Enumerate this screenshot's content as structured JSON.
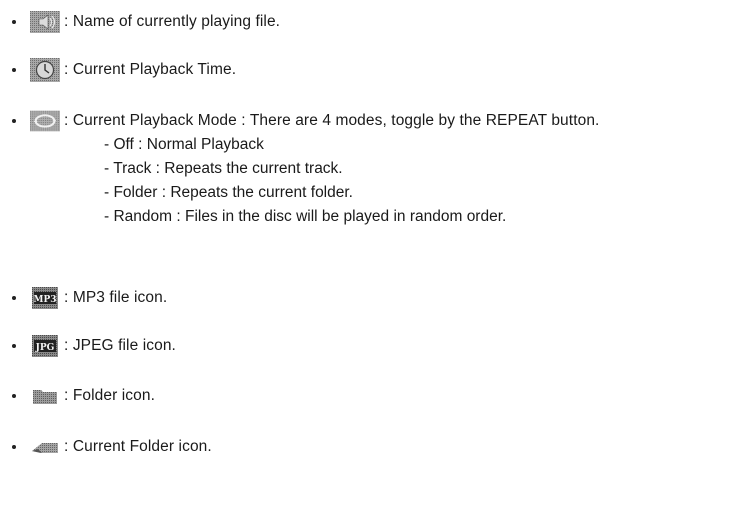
{
  "items": [
    {
      "icon": "speaker-icon",
      "text": ": Name of currently playing file."
    },
    {
      "icon": "clock-icon",
      "text": ": Current Playback Time."
    },
    {
      "icon": "repeat-icon",
      "text": ": Current Playback Mode : There are 4 modes, toggle by the REPEAT button."
    },
    {
      "icon": "mp3-file-icon",
      "text": ": MP3 file icon.",
      "icon_label": "MP3"
    },
    {
      "icon": "jpeg-file-icon",
      "text": ": JPEG file icon.",
      "icon_label": "JPG"
    },
    {
      "icon": "folder-icon",
      "text": ": Folder icon."
    },
    {
      "icon": "current-folder-icon",
      "text": ": Current Folder icon."
    }
  ],
  "modes": [
    "- Off : Normal Playback",
    "- Track : Repeats the current track.",
    "- Folder : Repeats the current folder.",
    "- Random : Files in the disc will be played in random order."
  ]
}
